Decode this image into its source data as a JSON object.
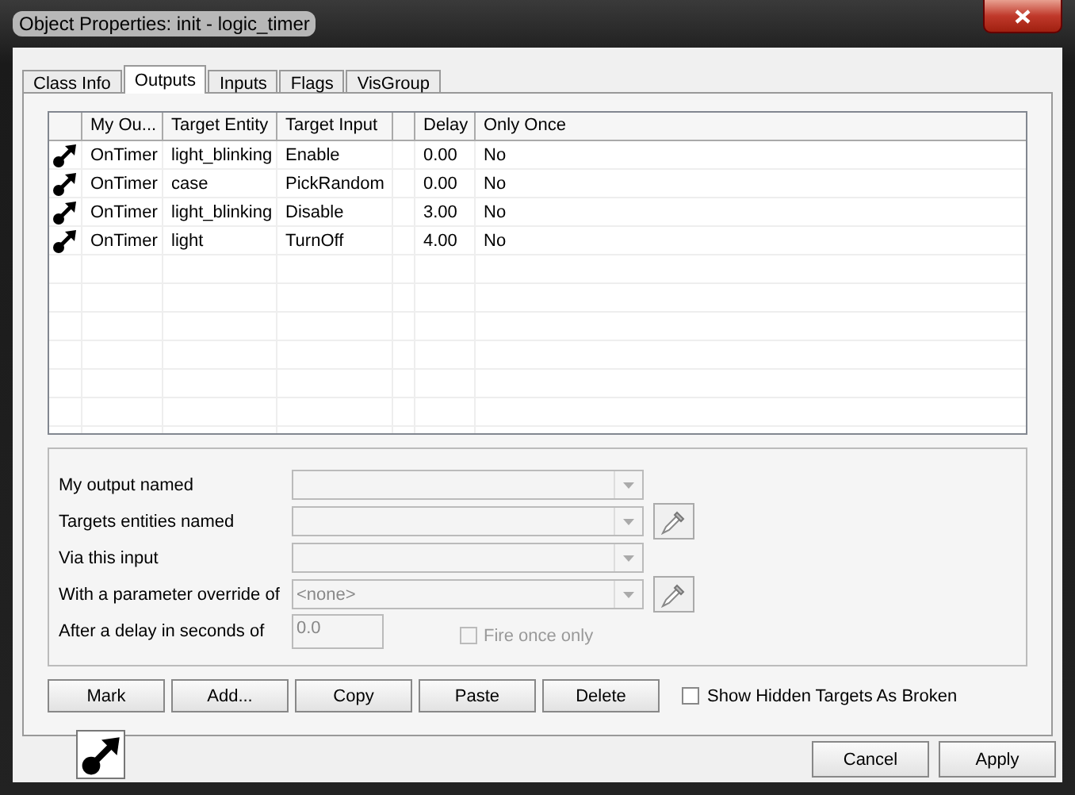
{
  "window": {
    "title": "Object Properties: init - logic_timer"
  },
  "tabs": [
    {
      "label": "Class Info",
      "selected": false
    },
    {
      "label": "Outputs",
      "selected": true
    },
    {
      "label": "Inputs",
      "selected": false
    },
    {
      "label": "Flags",
      "selected": false
    },
    {
      "label": "VisGroup",
      "selected": false
    }
  ],
  "table": {
    "columns": [
      "My Ou...",
      "Target Entity",
      "Target Input",
      "Delay",
      "Only Once"
    ],
    "rows": [
      {
        "output": "OnTimer",
        "target": "light_blinking",
        "input": "Enable",
        "delay": "0.00",
        "once": "No"
      },
      {
        "output": "OnTimer",
        "target": "case",
        "input": "PickRandom",
        "delay": "0.00",
        "once": "No"
      },
      {
        "output": "OnTimer",
        "target": "light_blinking",
        "input": "Disable",
        "delay": "3.00",
        "once": "No"
      },
      {
        "output": "OnTimer",
        "target": "light",
        "input": "TurnOff",
        "delay": "4.00",
        "once": "No"
      }
    ]
  },
  "form": {
    "fields": [
      {
        "label": "My output named",
        "kind": "combo",
        "picker": false,
        "disabled": true
      },
      {
        "label": "Targets entities named",
        "kind": "combo",
        "picker": true,
        "disabled": true
      },
      {
        "label": "Via this input",
        "kind": "combo",
        "picker": false,
        "disabled": true
      },
      {
        "label": "With a parameter override of",
        "kind": "combo",
        "value": "<none>",
        "picker": true,
        "disabled": true
      },
      {
        "label": "After a delay in seconds of",
        "kind": "text",
        "value": "0.0",
        "picker": false,
        "disabled": true
      }
    ],
    "fire_once": {
      "label": "Fire once only",
      "checked": false,
      "disabled": true
    }
  },
  "actions": [
    "Mark",
    "Add...",
    "Copy",
    "Paste",
    "Delete"
  ],
  "show_hidden": {
    "label": "Show Hidden Targets As Broken",
    "checked": false
  },
  "buttons": [
    "Cancel",
    "Apply"
  ]
}
